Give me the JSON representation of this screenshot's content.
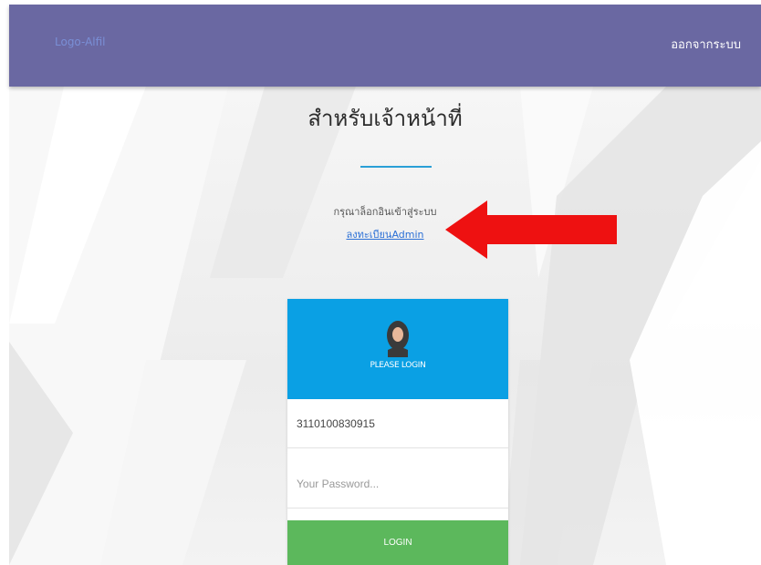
{
  "navbar": {
    "brand": "Logo-Alfil",
    "logout_label": "ออกจากระบบ",
    "color": "#6a68a2"
  },
  "main": {
    "title": "สำหรับเจ้าหน้าที่",
    "prompt": "กรุณาล็อกอินเข้าสู่ระบบ",
    "register_link": "ลงทะเบียนAdmin"
  },
  "login": {
    "header_label": "PLEASE LOGIN",
    "header_color": "#0aa0e4",
    "username_value": "3110100830915",
    "password_placeholder": "Your Password...",
    "button_label": "LOGIN",
    "button_color": "#5cb85c",
    "avatar_icon": "user-avatar-icon"
  },
  "annotation": {
    "arrow_color": "#ee1111",
    "arrow_icon": "red-arrow-icon"
  }
}
